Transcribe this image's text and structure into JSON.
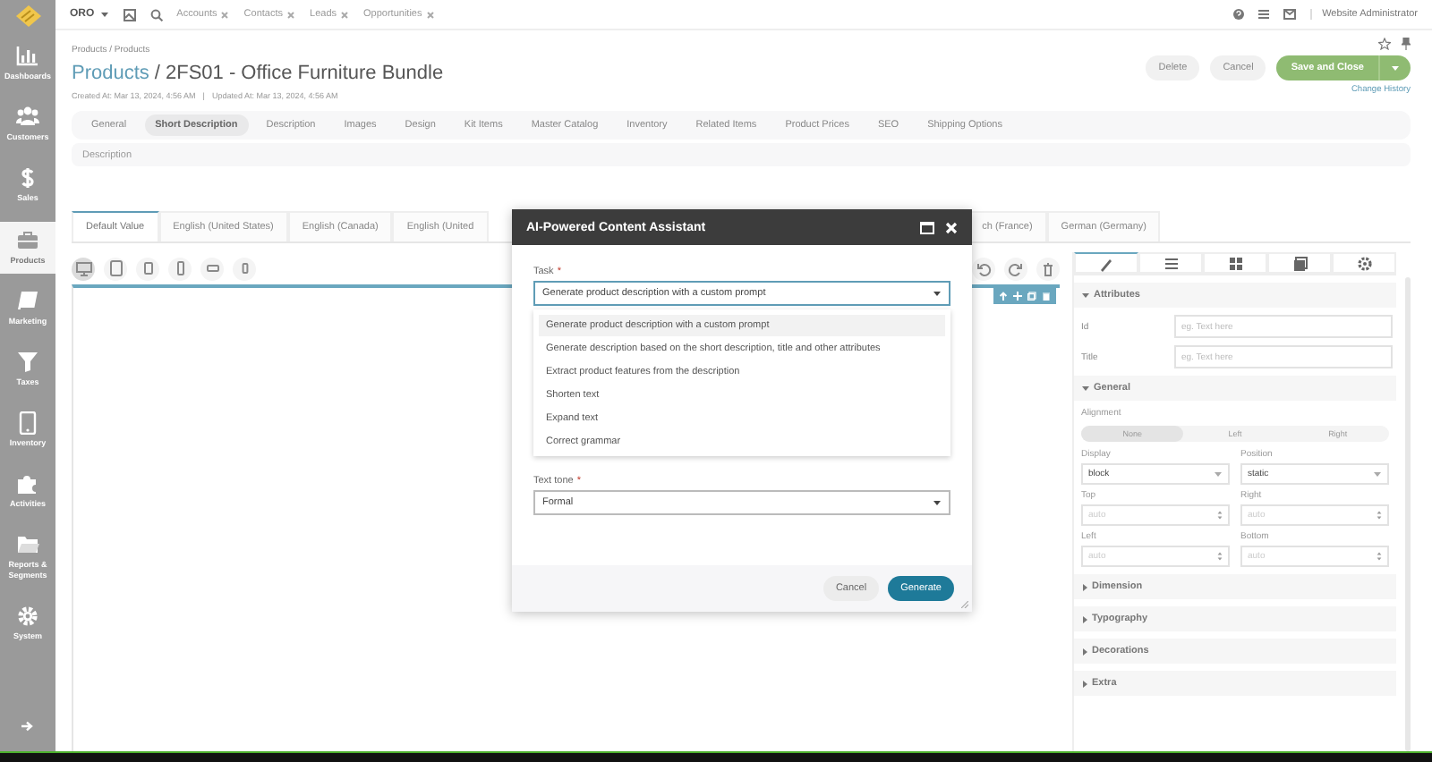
{
  "sidebar": {
    "items": [
      {
        "label": "Dashboards",
        "selected": false
      },
      {
        "label": "Customers",
        "selected": false
      },
      {
        "label": "Sales",
        "selected": false
      },
      {
        "label": "Products",
        "selected": true
      },
      {
        "label": "Marketing",
        "selected": false
      },
      {
        "label": "Taxes",
        "selected": false
      },
      {
        "label": "Inventory",
        "selected": false
      },
      {
        "label": "Activities",
        "selected": false
      },
      {
        "label": "Reports & Segments",
        "selected": false
      },
      {
        "label": "System",
        "selected": false
      }
    ]
  },
  "top_bar": {
    "menu": "ORO",
    "pinned": [
      "Accounts",
      "Contacts",
      "Leads",
      "Opportunities"
    ],
    "user": "Website Administrator"
  },
  "breadcrumb": "Products / Products",
  "title": {
    "link": "Products",
    "separator": "/",
    "name": "2FS01 - Office Furniture Bundle"
  },
  "actions": {
    "buttons": [
      "Delete",
      "Cancel"
    ],
    "primary": "Save and Close",
    "change_history": "Change History"
  },
  "meta": [
    "Created At: Mar 13, 2024, 4:56 AM",
    "Updated At: Mar 13, 2024, 4:56 AM"
  ],
  "meta_separator": "|",
  "tabs": [
    {
      "label": "General",
      "selected": false
    },
    {
      "label": "Short Description",
      "selected": true
    },
    {
      "label": "Description",
      "selected": false
    },
    {
      "label": "Images",
      "selected": false
    },
    {
      "label": "Design",
      "selected": false
    },
    {
      "label": "Kit Items",
      "selected": false
    },
    {
      "label": "Master Catalog",
      "selected": false
    },
    {
      "label": "Inventory",
      "selected": false
    },
    {
      "label": "Related Items",
      "selected": false
    },
    {
      "label": "Product Prices",
      "selected": false
    },
    {
      "label": "SEO",
      "selected": false
    },
    {
      "label": "Shipping Options",
      "selected": false
    }
  ],
  "section_title": "Description",
  "locale_tabs": [
    {
      "label": "Default Value",
      "selected": true
    },
    {
      "label": "English (United States)",
      "selected": false
    },
    {
      "label": "English (Canada)",
      "selected": false
    },
    {
      "label": "English (United",
      "selected": false
    },
    {
      "label": "ch (France)",
      "selected": false
    },
    {
      "label": "German (Germany)",
      "selected": false
    }
  ],
  "devices": [
    {
      "selected": true
    },
    {
      "selected": false
    },
    {
      "selected": false
    },
    {
      "selected": false
    },
    {
      "selected": false
    },
    {
      "selected": false
    }
  ],
  "style_panel": {
    "tabs": [
      {
        "selected": true
      },
      {
        "selected": false
      },
      {
        "selected": false
      },
      {
        "selected": false
      },
      {
        "selected": false
      }
    ],
    "attributes": {
      "title": "Attributes",
      "expanded": true,
      "fields": [
        {
          "label": "Id",
          "placeholder": "eg. Text here"
        },
        {
          "label": "Title",
          "placeholder": "eg. Text here"
        }
      ]
    },
    "general": {
      "title": "General",
      "expanded": true,
      "alignment": {
        "label": "Alignment",
        "options": [
          {
            "label": "None",
            "selected": true
          },
          {
            "label": "Left",
            "selected": false
          },
          {
            "label": "Right",
            "selected": false
          }
        ]
      },
      "fields": [
        {
          "label": "Display",
          "kind": "select",
          "value": "block"
        },
        {
          "label": "Position",
          "kind": "select",
          "value": "static"
        },
        {
          "label": "Top",
          "kind": "number",
          "placeholder": "auto"
        },
        {
          "label": "Right",
          "kind": "number",
          "placeholder": "auto"
        },
        {
          "label": "Left",
          "kind": "number",
          "placeholder": "auto"
        },
        {
          "label": "Bottom",
          "kind": "number",
          "placeholder": "auto"
        }
      ]
    },
    "sections": [
      {
        "title": "Dimension",
        "expanded": false
      },
      {
        "title": "Typography",
        "expanded": false
      },
      {
        "title": "Decorations",
        "expanded": false
      },
      {
        "title": "Extra",
        "expanded": false
      }
    ]
  },
  "dialog": {
    "title": "AI-Powered Content Assistant",
    "task": {
      "label": "Task",
      "required": "*",
      "value": "Generate product description with a custom prompt",
      "options": [
        {
          "label": "Generate product description with a custom prompt",
          "selected": true
        },
        {
          "label": "Generate description based on the short description, title and other attributes",
          "selected": false
        },
        {
          "label": "Extract product features from the description",
          "selected": false
        },
        {
          "label": "Shorten text",
          "selected": false
        },
        {
          "label": "Expand text",
          "selected": false
        },
        {
          "label": "Correct grammar",
          "selected": false
        }
      ]
    },
    "tone": {
      "label": "Text tone",
      "required": "*",
      "value": "Formal"
    },
    "buttons": {
      "cancel": "Cancel",
      "submit": "Generate"
    }
  }
}
